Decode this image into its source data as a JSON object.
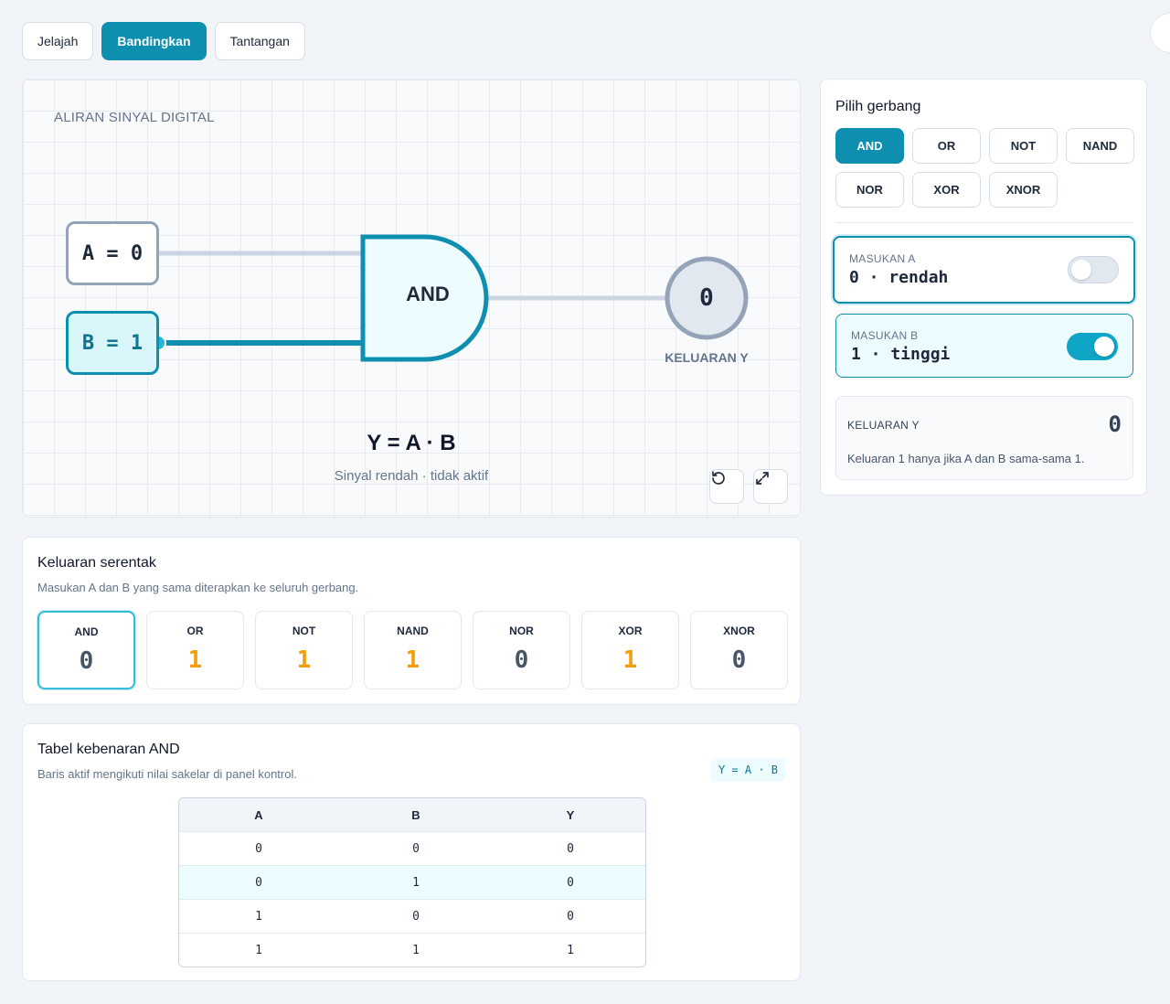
{
  "tabs": [
    {
      "label": "Jelajah",
      "active": false
    },
    {
      "label": "Bandingkan",
      "active": true
    },
    {
      "label": "Tantangan",
      "active": false
    }
  ],
  "canvas": {
    "title": "ALIRAN SINYAL DIGITAL",
    "input_a_label": "A = 0",
    "input_b_label": "B = 1",
    "gate_label": "AND",
    "output_value": "0",
    "output_label": "KELUARAN Y",
    "formula": "Y = A · B",
    "signal_text": "Sinyal rendah · tidak aktif",
    "reset_icon": "reset-icon",
    "fullscreen_icon": "expand-icon"
  },
  "panel": {
    "title": "Pilih gerbang",
    "gates": [
      "AND",
      "OR",
      "NOT",
      "NAND",
      "NOR",
      "XOR",
      "XNOR"
    ],
    "selected_gate": "AND",
    "input_a": {
      "caption": "MASUKAN A",
      "value": "0 · rendah",
      "on": false
    },
    "input_b": {
      "caption": "MASUKAN B",
      "value": "1 · tinggi",
      "on": true
    },
    "output": {
      "caption": "KELUARAN Y",
      "value": "0",
      "description": "Keluaran 1 hanya jika A dan B sama-sama 1."
    }
  },
  "simultaneous": {
    "title": "Keluaran serentak",
    "subtitle": "Masukan A dan B yang sama diterapkan ke seluruh gerbang.",
    "items": [
      {
        "name": "AND",
        "value": "0"
      },
      {
        "name": "OR",
        "value": "1"
      },
      {
        "name": "NOT",
        "value": "1"
      },
      {
        "name": "NAND",
        "value": "1"
      },
      {
        "name": "NOR",
        "value": "0"
      },
      {
        "name": "XOR",
        "value": "1"
      },
      {
        "name": "XNOR",
        "value": "0"
      }
    ]
  },
  "truth_table": {
    "title": "Tabel kebenaran AND",
    "subtitle": "Baris aktif mengikuti nilai sakelar di panel kontrol.",
    "expression": "Y = A · B",
    "headers": [
      "A",
      "B",
      "Y"
    ],
    "rows": [
      [
        "0",
        "0",
        "0"
      ],
      [
        "0",
        "1",
        "0"
      ],
      [
        "1",
        "0",
        "0"
      ],
      [
        "1",
        "1",
        "1"
      ]
    ],
    "active_row": 1
  },
  "colors": {
    "accent": "#0e8fb0",
    "high_signal": "#0e8fb0",
    "low_signal": "#cbd5e1",
    "output_one": "#f59e0b",
    "output_zero": "#475569"
  }
}
